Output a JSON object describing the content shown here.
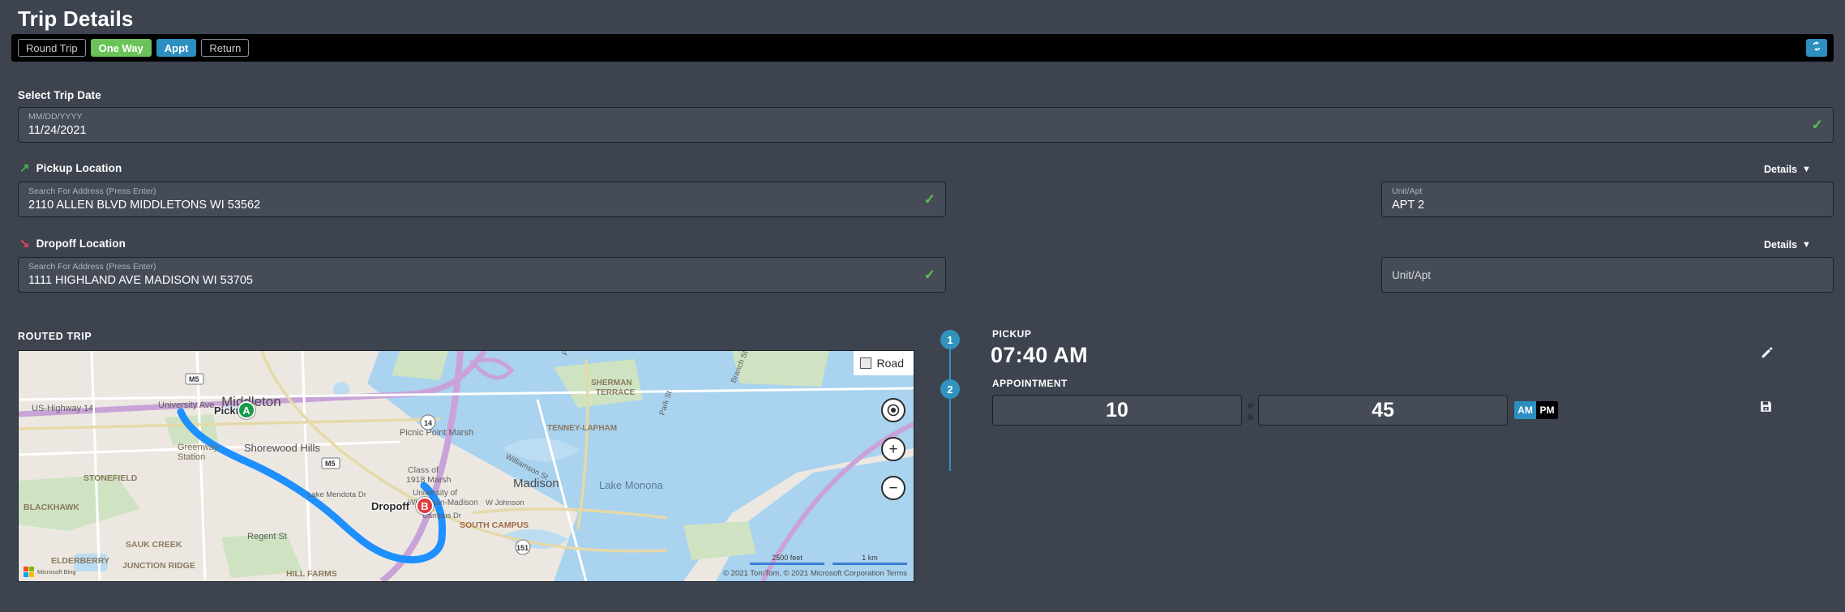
{
  "page": {
    "title": "Trip Details"
  },
  "trip_type_bar": {
    "options": [
      {
        "label": "Round Trip",
        "state": "inactive"
      },
      {
        "label": "One Way",
        "state": "active-green"
      },
      {
        "label": "Appt",
        "state": "active-blue"
      },
      {
        "label": "Return",
        "state": "inactive"
      }
    ],
    "refresh_icon": "refresh-sync-icon"
  },
  "trip_date": {
    "section_label": "Select Trip Date",
    "placeholder": "MM/DD/YYYY",
    "value": "11/24/2021",
    "valid": true
  },
  "pickup": {
    "heading": "Pickup Location",
    "arrow_icon": "arrow-up-right-icon",
    "details_label": "Details",
    "chevron_icon": "chevron-down-icon",
    "address_placeholder": "Search For Address (Press Enter)",
    "address_value": "2110 ALLEN BLVD MIDDLETONS WI 53562",
    "valid": true,
    "unit_label": "Unit/Apt",
    "unit_value": "APT 2"
  },
  "dropoff": {
    "heading": "Dropoff Location",
    "arrow_icon": "arrow-down-right-icon",
    "details_label": "Details",
    "chevron_icon": "chevron-down-icon",
    "address_placeholder": "Search For Address (Press Enter)",
    "address_value": "1111 HIGHLAND AVE MADISON WI 53705",
    "valid": true,
    "unit_placeholder": "Unit/Apt",
    "unit_value": ""
  },
  "map": {
    "section_label": "ROUTED TRIP",
    "view_button": "Road",
    "view_icon": "map-layers-icon",
    "locate_icon": "locate-me-icon",
    "zoom_in_icon": "plus-icon",
    "zoom_out_icon": "minus-icon",
    "pickup_marker": {
      "letter": "A",
      "label": "Pickup"
    },
    "dropoff_marker": {
      "letter": "B",
      "label": "Dropoff"
    },
    "provider": "Microsoft Bing",
    "attribution": "© 2021 TomTom, © 2021 Microsoft Corporation   Terms",
    "scale_imperial": "2500 feet",
    "scale_metric": "1 km",
    "labels": [
      "US-Highway 14",
      "University Ave",
      "Middleton",
      "M5",
      "Greenway Station",
      "STONEFIELD",
      "BLACKHAWK",
      "SAUK CREEK",
      "JUNCTION RIDGE",
      "ELDERBERRY",
      "HILL FARMS",
      "Shorewood Hills",
      "Picnic Point Marsh",
      "Class of 1918 Marsh",
      "Lake Mendota Dr",
      "University of Wisconsin-Madison",
      "Madison",
      "SHERMAN TERRACE",
      "TENNEY-LAPHAM",
      "SOUTH CAMPUS",
      "Regent St",
      "Campus Dr",
      "W Johnson",
      "Lake Monona",
      "Branch St",
      "Park St",
      "Williamson St",
      "14",
      "151"
    ]
  },
  "schedule": {
    "steps": [
      {
        "number": "1",
        "caption": "PICKUP",
        "time": "07:40 AM"
      },
      {
        "number": "2",
        "caption": "APPOINTMENT"
      }
    ],
    "appointment": {
      "hour": "10",
      "minute": "45",
      "meridiem_options": [
        {
          "label": "AM",
          "selected": true
        },
        {
          "label": "PM",
          "selected": false
        }
      ]
    },
    "edit_icon": "pencil-edit-icon",
    "save_icon": "floppy-save-icon"
  },
  "colors": {
    "page_bg": "#3d4450",
    "field_bg": "#454c58",
    "accent_blue": "#2d8fc0",
    "accent_green": "#6ac259",
    "valid_green": "#5ec04f",
    "pickup_green": "#179b4a",
    "dropoff_red": "#e03b3b",
    "route_blue": "#1e90ff"
  }
}
